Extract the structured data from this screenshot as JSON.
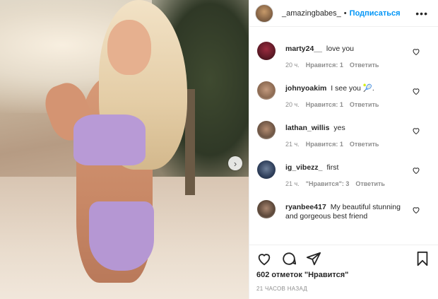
{
  "post": {
    "username": "_amazingbabes_",
    "separator": "•",
    "follow_label": "Подписаться",
    "more_label": "•••",
    "likes_text": "602 отметок \"Нравится\"",
    "time_text": "21 ЧАСОВ НАЗАД"
  },
  "comments": [
    {
      "user": "marty24__",
      "text": "love you",
      "time": "20 ч.",
      "likes": "Нравится: 1",
      "reply": "Ответить"
    },
    {
      "user": "johnyoakim",
      "text": "I see you 🎾.",
      "time": "20 ч.",
      "likes": "Нравится: 1",
      "reply": "Ответить"
    },
    {
      "user": "lathan_willis",
      "text": "yes",
      "time": "21 ч.",
      "likes": "Нравится: 1",
      "reply": "Ответить"
    },
    {
      "user": "ig_vibezz_",
      "text": "first",
      "time": "21 ч.",
      "likes": "\"Нравится\": 3",
      "reply": "Ответить"
    },
    {
      "user": "ryanbee417",
      "text": "My beautiful stunning and gorgeous best friend",
      "time": "",
      "likes": "",
      "reply": ""
    }
  ],
  "icons": {
    "next": "chevron-right-icon",
    "like": "heart-icon",
    "comment": "comment-icon",
    "share": "paper-plane-icon",
    "save": "bookmark-icon",
    "comment_like": "heart-icon"
  },
  "colors": {
    "accent": "#0095f6",
    "text": "#262626",
    "muted": "#8e8e8e"
  }
}
